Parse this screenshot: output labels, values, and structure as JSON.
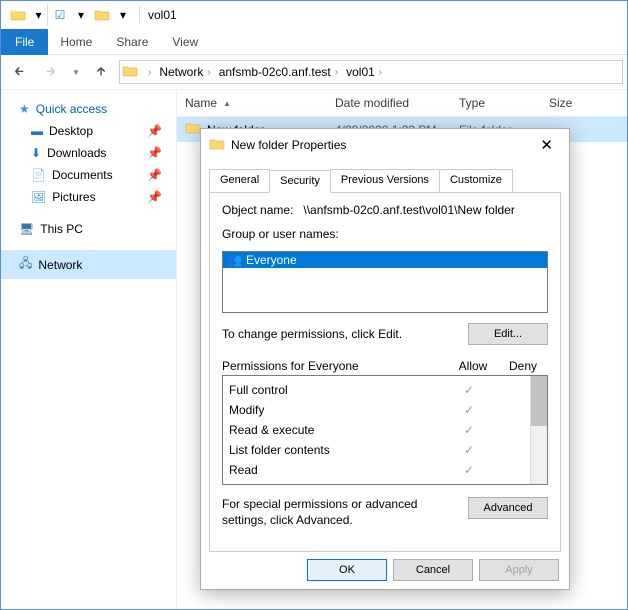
{
  "titlebar": {
    "title": "vol01"
  },
  "menubar": {
    "file": "File",
    "home": "Home",
    "share": "Share",
    "view": "View"
  },
  "breadcrumb": {
    "p1": "Network",
    "p2": "anfsmb-02c0.anf.test",
    "p3": "vol01"
  },
  "columns": {
    "name": "Name",
    "date": "Date modified",
    "type": "Type",
    "size": "Size"
  },
  "row0": {
    "name": "New folder",
    "date": "4/29/2020 1:23 PM",
    "type": "File folder"
  },
  "sidebar": {
    "quick": "Quick access",
    "desktop": "Desktop",
    "downloads": "Downloads",
    "documents": "Documents",
    "pictures": "Pictures",
    "thispc": "This PC",
    "network": "Network"
  },
  "dialog": {
    "title": "New folder Properties",
    "tabs": {
      "general": "General",
      "security": "Security",
      "previous": "Previous Versions",
      "customize": "Customize"
    },
    "object_label": "Object name:",
    "object_value": "\\\\anfsmb-02c0.anf.test\\vol01\\New folder",
    "group_label": "Group or user names:",
    "group_item": "Everyone",
    "change_text": "To change permissions, click Edit.",
    "edit_btn": "Edit...",
    "perm_header": "Permissions for Everyone",
    "allow": "Allow",
    "deny": "Deny",
    "perms": {
      "full": "Full control",
      "modify": "Modify",
      "rx": "Read & execute",
      "list": "List folder contents",
      "read": "Read"
    },
    "adv_text": "For special permissions or advanced settings, click Advanced.",
    "adv_btn": "Advanced",
    "ok": "OK",
    "cancel": "Cancel",
    "apply": "Apply"
  }
}
